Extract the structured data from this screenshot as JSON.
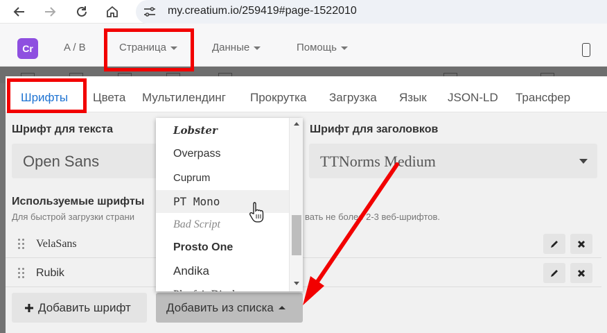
{
  "browser": {
    "url": "my.creatium.io/259419#page-1522010"
  },
  "header": {
    "logo_text": "Cr",
    "menu": [
      {
        "label": "A / B"
      },
      {
        "label": "Страница"
      },
      {
        "label": "Данные"
      },
      {
        "label": "Помощь"
      }
    ]
  },
  "tabs": [
    {
      "label": "Шрифты"
    },
    {
      "label": "Цвета"
    },
    {
      "label": "Мультилендинг"
    },
    {
      "label": "Прокрутка"
    },
    {
      "label": "Загрузка"
    },
    {
      "label": "Язык"
    },
    {
      "label": "JSON-LD"
    },
    {
      "label": "Трансфер"
    }
  ],
  "fonts_panel": {
    "text_font_label": "Шрифт для текста",
    "text_font_value": "Open Sans",
    "heading_font_label": "Шрифт для заголовков",
    "heading_font_value": "TTNorms Medium",
    "used_fonts_label": "Используемые шрифты",
    "hint_left": "Для быстрой загрузки страни",
    "hint_right": "вать не более 2-3 веб-шрифтов.",
    "used_fonts": [
      {
        "name": "VelaSans"
      },
      {
        "name": "Rubik"
      }
    ],
    "add_font_label": "Добавить шрифт",
    "add_from_list_label": "Добавить из списка"
  },
  "dropdown": {
    "items": [
      {
        "label": "Lobster"
      },
      {
        "label": "Overpass"
      },
      {
        "label": "Cuprum"
      },
      {
        "label": "PT Mono"
      },
      {
        "label": "Bad Script"
      },
      {
        "label": "Prosto One"
      },
      {
        "label": "Andika"
      },
      {
        "label": "Playfair Display"
      }
    ]
  },
  "colors": {
    "accent": "#1e73d2",
    "logo": "#8e4fe0",
    "annotation": "#f20000"
  }
}
